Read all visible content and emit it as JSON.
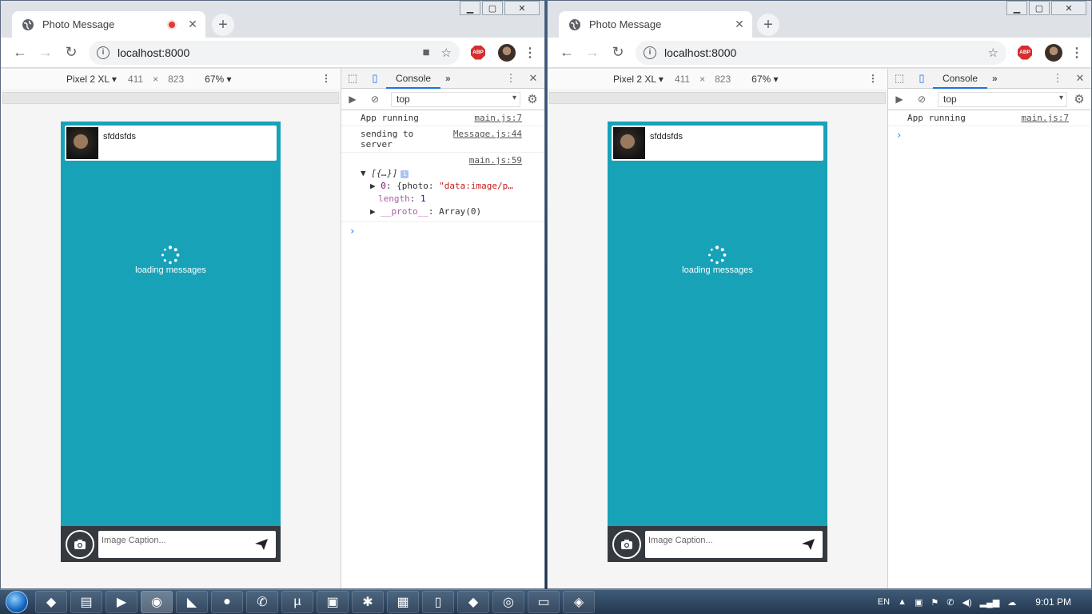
{
  "windows": [
    {
      "side": "left",
      "tab_title": "Photo Message",
      "recording": true,
      "url": "localhost:8000",
      "device": "Pixel 2 XL ▾",
      "width": "411",
      "height": "823",
      "zoom": "67% ▾",
      "console_tab": "Console",
      "context": "top",
      "phone": {
        "message_text": "sfddsfds",
        "loading_text": "loading messages",
        "caption_placeholder": "Image Caption..."
      }
    },
    {
      "side": "right",
      "tab_title": "Photo Message",
      "recording": false,
      "url": "localhost:8000",
      "device": "Pixel 2 XL ▾",
      "width": "411",
      "height": "823",
      "zoom": "67% ▾",
      "console_tab": "Console",
      "context": "top",
      "phone": {
        "message_text": "sfddsfds",
        "loading_text": "loading messages",
        "caption_placeholder": "Image Caption..."
      }
    }
  ],
  "left_console": {
    "log1": {
      "text": "App running",
      "src": "main.js:7"
    },
    "log2": {
      "text": "sending to server",
      "src": "Message.js:44"
    },
    "log3_src": "main.js:59",
    "obj_head": "[{…}]",
    "obj_line1_key": "0",
    "obj_line1_prefix": ": {photo: ",
    "obj_line1_val": "\"data:image/p…",
    "obj_line2_key": "length",
    "obj_line2_val": "1",
    "obj_line3_key": "__proto__",
    "obj_line3_val": ": Array(0)"
  },
  "right_console": {
    "log1": {
      "text": "App running",
      "src": "main.js:7"
    }
  },
  "taskbar": {
    "lang": "EN",
    "time": "9:01 PM"
  },
  "colors": {
    "phone_bg": "#17a2b8",
    "footer_bg": "#343a40",
    "accent": "#1a73e8"
  }
}
